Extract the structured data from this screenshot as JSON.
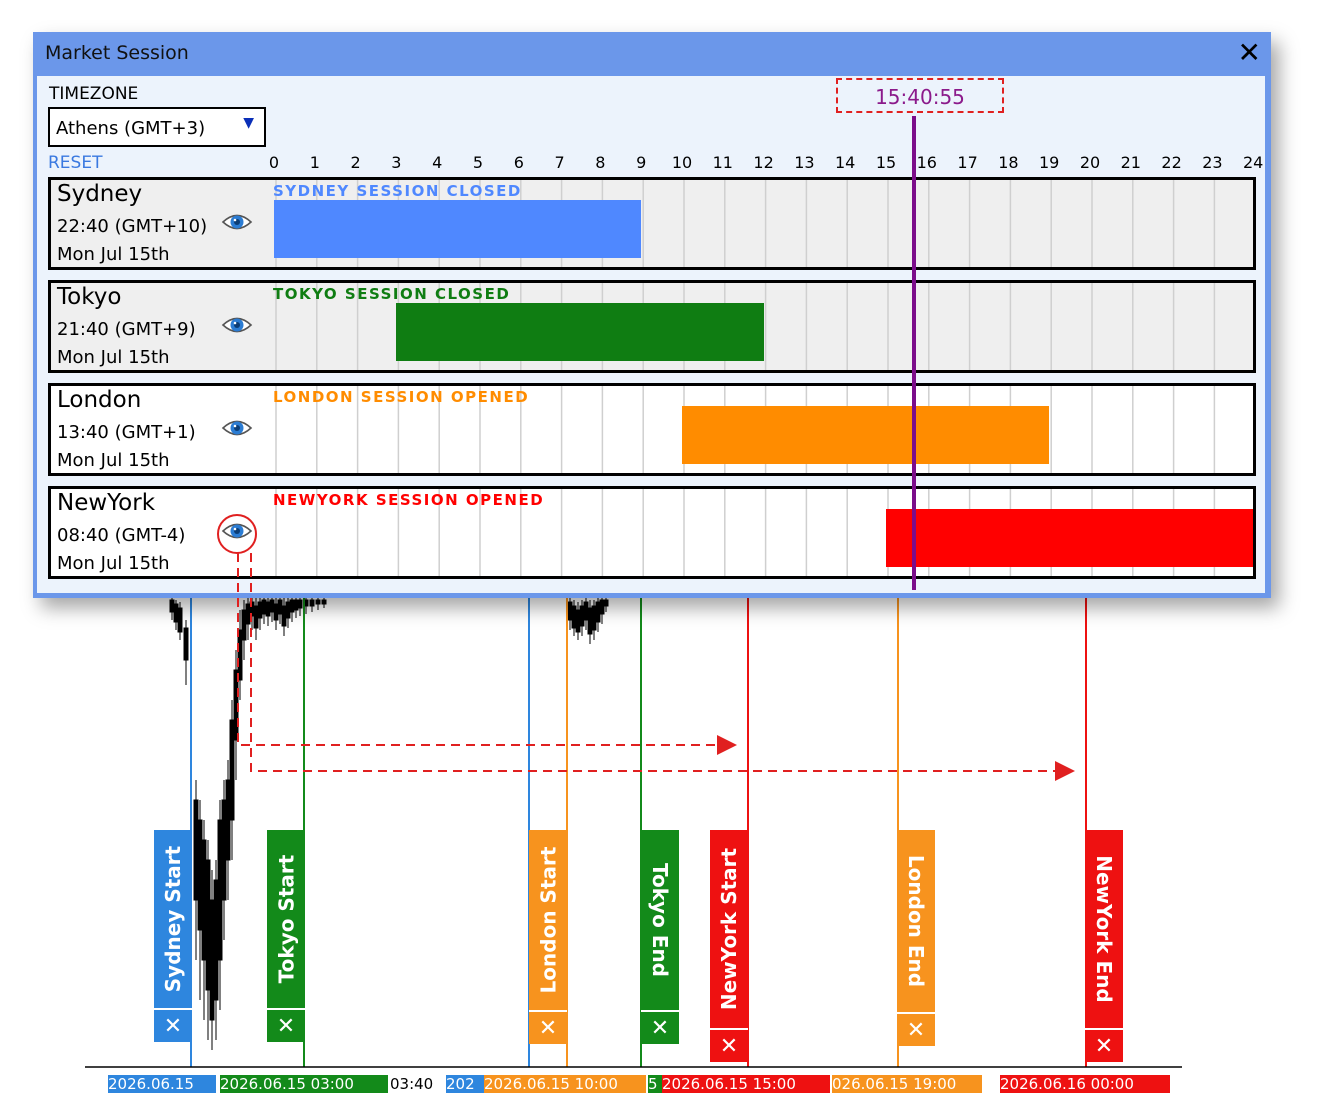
{
  "window": {
    "title": "Market Session"
  },
  "timezone": {
    "label": "TIMEZONE",
    "selected": "Athens (GMT+3)"
  },
  "reset_label": "RESET",
  "hours": [
    "0",
    "1",
    "2",
    "3",
    "4",
    "5",
    "6",
    "7",
    "8",
    "9",
    "10",
    "11",
    "12",
    "13",
    "14",
    "15",
    "16",
    "17",
    "18",
    "19",
    "20",
    "21",
    "22",
    "23",
    "24"
  ],
  "current_time": "15:40:55",
  "current_hour": 15.68,
  "sessions": [
    {
      "name": "Sydney",
      "time": "22:40 (GMT+10)",
      "date": "Mon Jul 15th",
      "status": "SYDNEY SESSION CLOSED",
      "color": "#4f88ff",
      "start": 0,
      "end": 9,
      "state": "closed"
    },
    {
      "name": "Tokyo",
      "time": "21:40 (GMT+9)",
      "date": "Mon Jul 15th",
      "status": "TOKYO SESSION CLOSED",
      "color": "#0f7d12",
      "start": 3,
      "end": 12,
      "state": "closed"
    },
    {
      "name": "London",
      "time": "13:40 (GMT+1)",
      "date": "Mon Jul 15th",
      "status": "LONDON SESSION OPENED",
      "color": "#ff8c00",
      "start": 10,
      "end": 19,
      "state": "opened"
    },
    {
      "name": "NewYork",
      "time": "08:40 (GMT-4)",
      "date": "Mon Jul 15th",
      "status": "NEWYORK SESSION OPENED",
      "color": "#ff0000",
      "start": 15,
      "end": 24,
      "state": "opened"
    }
  ],
  "chart_labels": [
    {
      "text": "Sydney Start",
      "color": "#2e86de"
    },
    {
      "text": "Tokyo Start",
      "color": "#138a1a"
    },
    {
      "text": "London Start",
      "color": "#f7931e"
    },
    {
      "text": "Tokyo End",
      "color": "#138a1a"
    },
    {
      "text": "NewYork Start",
      "color": "#ee1111"
    },
    {
      "text": "London End",
      "color": "#f7931e"
    },
    {
      "text": "NewYork End",
      "color": "#ee1111"
    }
  ],
  "close_glyph": "✕",
  "axis_dates": [
    {
      "text": "2026.06.15",
      "color": "#2e86de"
    },
    {
      "text": "2026.06.15 03:00",
      "color": "#138a1a"
    },
    {
      "text": "03:40",
      "color": "#ffffff"
    },
    {
      "text": "202",
      "color": "#2e86de"
    },
    {
      "text": "2026.06.15 10:00",
      "color": "#f7931e"
    },
    {
      "text": "5",
      "color": "#138a1a"
    },
    {
      "text": "2026.06.15 15:00",
      "color": "#ee1111"
    },
    {
      "text": "026.06.15 19:00",
      "color": "#f7931e"
    },
    {
      "text": "2026.06.16 00:00",
      "color": "#ee1111"
    }
  ]
}
